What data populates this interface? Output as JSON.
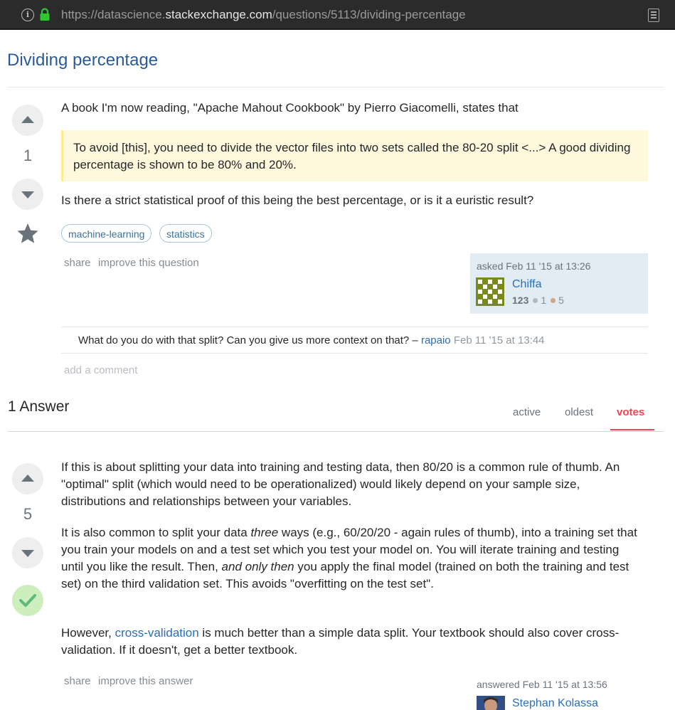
{
  "browser": {
    "url_prefix": "https://datascience.",
    "url_domain": "stackexchange.com",
    "url_path": "/questions/5113/dividing-percentage",
    "icons": [
      "info-icon",
      "lock-icon",
      "reader-view-icon"
    ]
  },
  "question": {
    "title": "Dividing percentage",
    "votes": "1",
    "intro": "A book I'm now reading, \"Apache Mahout Cookbook\" by Pierro Giacomelli, states that",
    "quote": "To avoid [this], you need to divide the vector files into two sets called the 80-20 split <...> A good dividing percentage is shown to be 80% and 20%.",
    "body": "Is there a strict statistical proof of this being the best percentage, or is it a euristic result?",
    "tags": [
      "machine-learning",
      "statistics"
    ],
    "share_label": "share",
    "improve_label": "improve this question",
    "asked": "asked Feb 11 '15 at 13:26",
    "owner": {
      "name": "Chiffa",
      "rep": "123",
      "silver": "1",
      "bronze": "5"
    },
    "comment": {
      "text": "What do you do with that split? Can you give us more context on that? – ",
      "user": "rapaio",
      "date": "Feb 11 '15 at 13:44"
    },
    "add_comment": "add a comment"
  },
  "answers_header": {
    "count_label": "1 Answer",
    "tabs": [
      "active",
      "oldest",
      "votes"
    ],
    "selected_tab": "votes"
  },
  "answer": {
    "votes": "5",
    "accepted": true,
    "p1": "If this is about splitting your data into training and testing data, then 80/20 is a common rule of thumb. An \"optimal\" split (which would need to be operationalized) would likely depend on your sample size, distributions and relationships between your variables.",
    "p2_a": "It is also common to split your data ",
    "p2_em1": "three",
    "p2_b": " ways (e.g., 60/20/20 - again rules of thumb), into a training set that you train your models on and a test set which you test your model on. You will iterate training and testing until you like the result. Then, ",
    "p2_em2": "and only then",
    "p2_c": " you apply the final model (trained on both the training and test set) on the third validation set. This avoids \"overfitting on the test set\".",
    "p3_a": "However, ",
    "p3_link": "cross-validation",
    "p3_b": " is much better than a simple data split. Your textbook should also cover cross-validation. If it doesn't, get a better textbook.",
    "share_label": "share",
    "improve_label": "improve this answer",
    "answered": "answered Feb 11 '15 at 13:56",
    "owner_name": "Stephan Kolassa"
  },
  "colors": {
    "title": "#2a5a9a",
    "link": "#2a6fb7",
    "owner_card": "#e1ecf4",
    "quote_bg": "#fff8dc",
    "selected_tab": "#f4434e",
    "accepted": "#cdeebd"
  }
}
